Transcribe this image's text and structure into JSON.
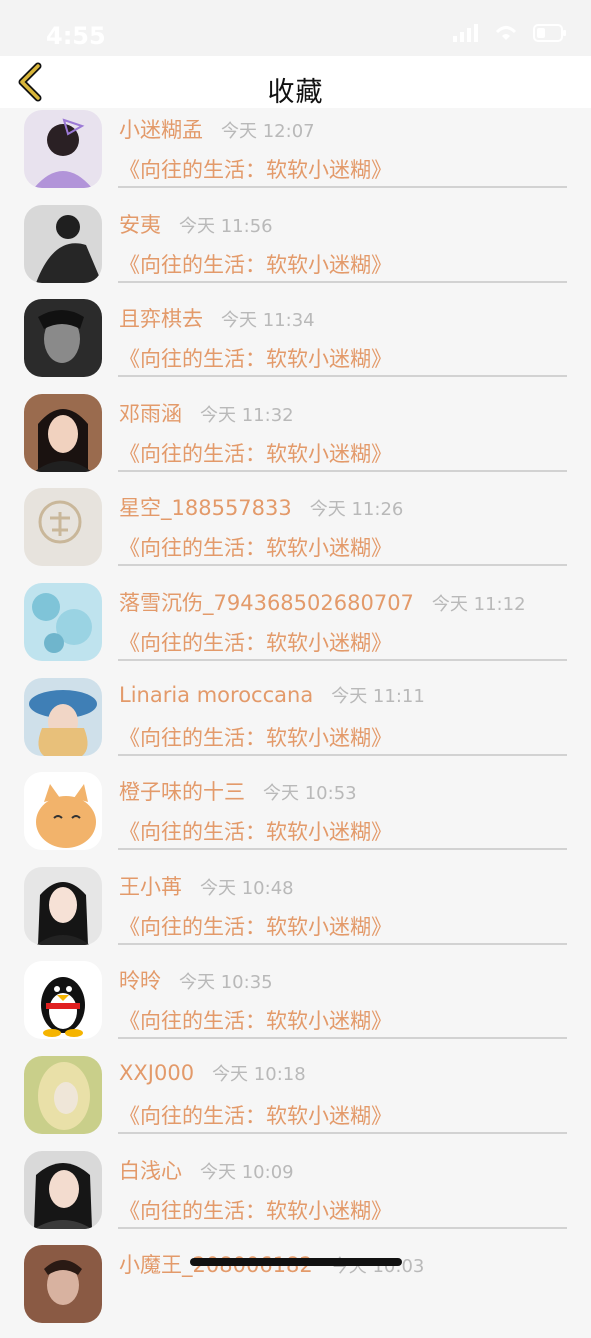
{
  "status": {
    "time": "4:55"
  },
  "nav": {
    "title": "收藏"
  },
  "list": [
    {
      "name": "小迷糊孟",
      "time": "今天 12:07",
      "favorite": "《向往的生活：软软小迷糊》"
    },
    {
      "name": "安夷",
      "time": "今天 11:56",
      "favorite": "《向往的生活：软软小迷糊》"
    },
    {
      "name": "且弈棋去",
      "time": "今天 11:34",
      "favorite": "《向往的生活：软软小迷糊》"
    },
    {
      "name": "邓雨涵",
      "time": "今天 11:32",
      "favorite": "《向往的生活：软软小迷糊》"
    },
    {
      "name": "星空_188557833",
      "time": "今天 11:26",
      "favorite": "《向往的生活：软软小迷糊》"
    },
    {
      "name": "落雪沉伤_794368502680707",
      "time": "今天 11:12",
      "favorite": "《向往的生活：软软小迷糊》"
    },
    {
      "name": "Linaria moroccana",
      "time": "今天 11:11",
      "favorite": "《向往的生活：软软小迷糊》"
    },
    {
      "name": "橙子味的十三",
      "time": "今天 10:53",
      "favorite": "《向往的生活：软软小迷糊》"
    },
    {
      "name": "王小苒",
      "time": "今天 10:48",
      "favorite": "《向往的生活：软软小迷糊》"
    },
    {
      "name": "昤昤",
      "time": "今天 10:35",
      "favorite": "《向往的生活：软软小迷糊》"
    },
    {
      "name": "XXJ000",
      "time": "今天 10:18",
      "favorite": "《向往的生活：软软小迷糊》"
    },
    {
      "name": "白浅心",
      "time": "今天 10:09",
      "favorite": "《向往的生活：软软小迷糊》"
    },
    {
      "name": "小魔王_208006182",
      "time": "今天 10:03",
      "favorite": ""
    }
  ],
  "colors": {
    "accent": "#e39a6a",
    "back_arrow": "#c9a227",
    "time_text": "#b9b9b9"
  }
}
